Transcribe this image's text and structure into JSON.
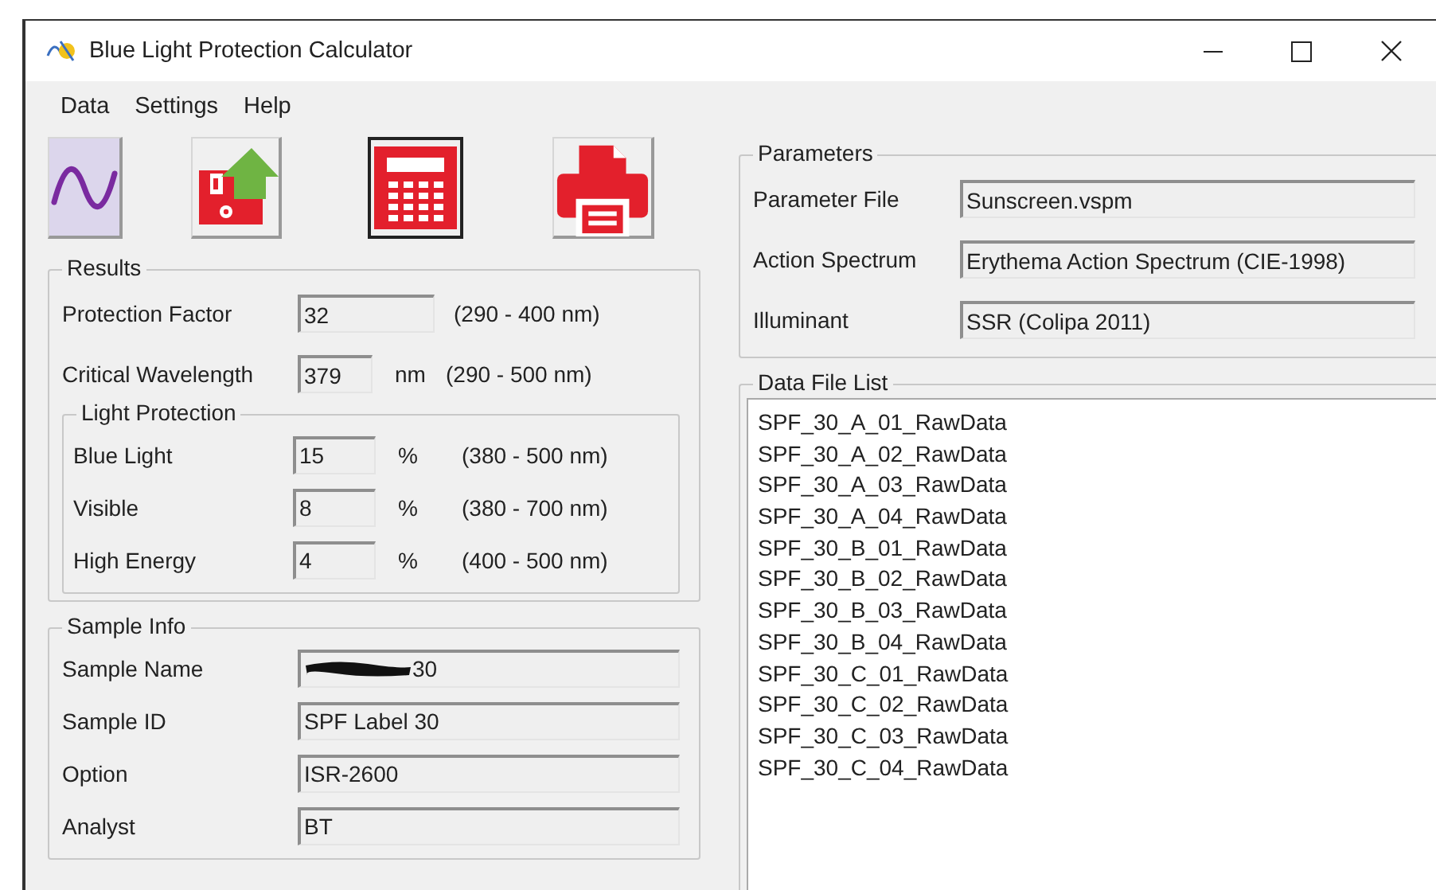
{
  "window": {
    "title": "Blue Light Protection Calculator"
  },
  "menu": [
    "Data",
    "Settings",
    "Help"
  ],
  "toolbar": [
    {
      "kind": "spectrum",
      "hovered": true,
      "focused": false
    },
    {
      "kind": "export",
      "hovered": false,
      "focused": false
    },
    {
      "kind": "calculate",
      "hovered": false,
      "focused": true
    },
    {
      "kind": "print",
      "hovered": false,
      "focused": false
    }
  ],
  "results": {
    "title": "Results",
    "rows": [
      {
        "label": "Protection Factor",
        "value": "32",
        "range": "(290 - 400 nm)",
        "wide": true
      },
      {
        "label": "Critical Wavelength",
        "value": "379",
        "unit": "nm",
        "range": "(290 - 500 nm)",
        "wide": false
      }
    ],
    "light_protection": {
      "title": "Light Protection",
      "rows": [
        {
          "label": "Blue Light",
          "value": "15",
          "unit": "%",
          "range": "(380 - 500 nm)"
        },
        {
          "label": "Visible",
          "value": "8",
          "unit": "%",
          "range": "(380 - 700 nm)"
        },
        {
          "label": "High Energy",
          "value": "4",
          "unit": "%",
          "range": "(400 - 500 nm)"
        }
      ]
    }
  },
  "sample_info": {
    "title": "Sample Info",
    "rows": [
      {
        "label": "Sample Name",
        "value": "30",
        "redacted": true
      },
      {
        "label": "Sample ID",
        "value": "SPF Label 30",
        "redacted": false
      },
      {
        "label": "Option",
        "value": "ISR-2600",
        "redacted": false
      },
      {
        "label": "Analyst",
        "value": "BT",
        "redacted": false
      }
    ]
  },
  "parameters": {
    "title": "Parameters",
    "rows": [
      {
        "label": "Parameter File",
        "value": "Sunscreen.vspm"
      },
      {
        "label": "Action Spectrum",
        "value": "Erythema Action Spectrum (CIE-1998)"
      },
      {
        "label": "Illuminant",
        "value": "SSR (Colipa 2011)"
      }
    ]
  },
  "data_file_list": {
    "title": "Data File List",
    "items": [
      "SPF_30_A_01_RawData",
      "SPF_30_A_02_RawData",
      "SPF_30_A_03_RawData",
      "SPF_30_A_04_RawData",
      "SPF_30_B_01_RawData",
      "SPF_30_B_02_RawData",
      "SPF_30_B_03_RawData",
      "SPF_30_B_04_RawData",
      "SPF_30_C_01_RawData",
      "SPF_30_C_02_RawData",
      "SPF_30_C_03_RawData",
      "SPF_30_C_04_RawData"
    ]
  }
}
